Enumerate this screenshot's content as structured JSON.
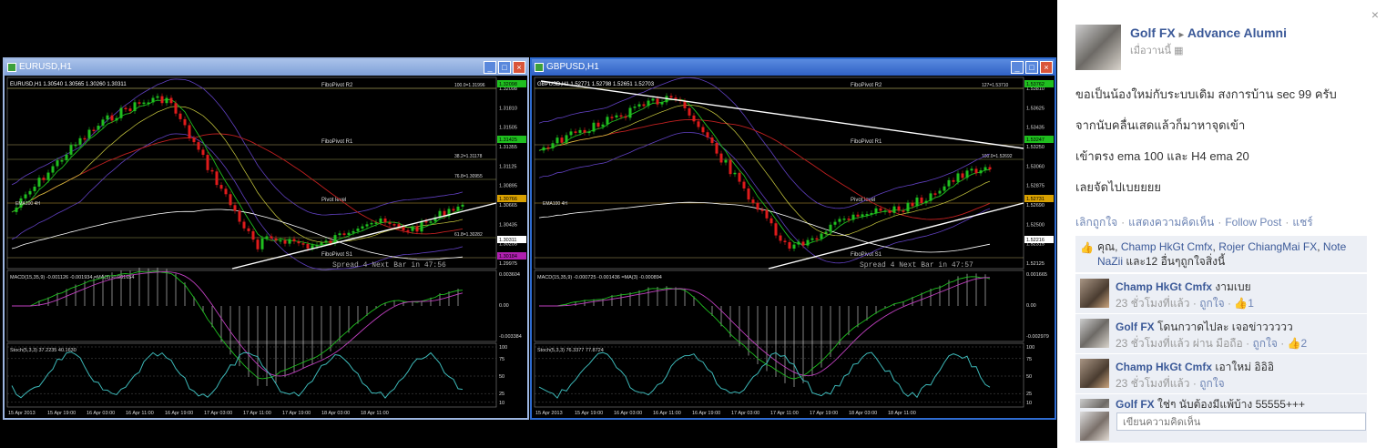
{
  "left_window": {
    "title": "EURUSD,H1",
    "ohlc_line": "EURUSD,H1  1.30540 1.30565 1.30260 1.30311",
    "pivot_labels": [
      "FiboPivot R2",
      "FiboPivot R1",
      "Pivot level",
      "FiboPivot S1"
    ],
    "fib_labels": [
      "100.0=1.31996",
      "38.2=1.31178",
      "76.8=1.30955",
      "61.8=1.30282"
    ],
    "price_ticks": [
      "1.32098",
      "1.31810",
      "1.31505",
      "1.31355",
      "1.31125",
      "1.30895",
      "1.30665",
      "1.30435",
      "1.30205",
      "1.29975"
    ],
    "highlight_prices": [
      "1.32098",
      "1.31425",
      "1.30766",
      "1.30311",
      "1.30184"
    ],
    "spread_text": "Spread  4   Next Bar in 47:56",
    "ema_label": "EMA100 4H",
    "macd_label": "MACD(15,35,9) -0.001126 -0.001934 =MA(3) -0.001654",
    "macd_ticks": [
      "0.003604",
      "0.00",
      "-0.003384"
    ],
    "stoch_label": "Stoch(5,3,3) 37.2235 40.1630",
    "stoch_ticks": [
      "100",
      "75",
      "50",
      "25",
      "10"
    ],
    "time_axis": [
      "15 Apr 2013",
      "15 Apr 19:00",
      "16 Apr 03:00",
      "16 Apr 11:00",
      "16 Apr 19:00",
      "17 Apr 03:00",
      "17 Apr 11:00",
      "17 Apr 19:00",
      "18 Apr 03:00",
      "18 Apr 11:00"
    ]
  },
  "right_window": {
    "title": "GBPUSD,H1",
    "ohlc_line": "GBPUSD,H1  1.52771 1.52798 1.52651 1.52703",
    "pivot_labels": [
      "FiboPivot R2",
      "FiboPivot R1",
      "Pivot level",
      "FiboPivot S1"
    ],
    "fib_labels": [
      "127=1.53710",
      "100.0=1.52692"
    ],
    "price_ticks": [
      "1.53810",
      "1.53625",
      "1.53435",
      "1.53250",
      "1.53060",
      "1.52875",
      "1.52690",
      "1.52500",
      "1.52315",
      "1.52125"
    ],
    "highlight_prices": [
      "1.53762",
      "1.53247",
      "1.52731",
      "1.52216"
    ],
    "spread_text": "Spread  4   Next Bar in 47:57",
    "ema_label": "EMA100 4H",
    "macd_label": "MACD(15,35,9) -0.000725 -0.001436 =MA(3) -0.000894",
    "macd_ticks": [
      "0.001665",
      "0.00",
      "-0.002979"
    ],
    "stoch_label": "Stoch(5,3,3) 76.3377 77.8724",
    "stoch_ticks": [
      "100",
      "75",
      "50",
      "25",
      "10"
    ],
    "time_axis": [
      "15 Apr 2013",
      "15 Apr 19:00",
      "16 Apr 03:00",
      "16 Apr 11:00",
      "16 Apr 19:00",
      "17 Apr 03:00",
      "17 Apr 11:00",
      "17 Apr 19:00",
      "18 Apr 03:00",
      "18 Apr 11:00"
    ]
  },
  "post": {
    "close_glyph": "×",
    "author": "Golf FX",
    "arrow": "▸",
    "group": "Advance Alumni",
    "time": "เมื่อวานนี้",
    "lines": [
      "ขอเป็นน้องใหม่กับระบบเดิม สงการบ้าน sec 99 ครับ",
      "จากนับคลื่นเสดแล้วก็มาหาจุดเข้า",
      "เข้าตรง ema 100 และ H4 ema 20",
      "เลยจัดไปเบยยยย"
    ],
    "actions": [
      "เลิกถูกใจ",
      "แสดงความคิดเห็น",
      "Follow Post",
      "แชร์"
    ],
    "likes": {
      "prefix": "คุณ, ",
      "names": [
        "Champ HkGt Cmfx",
        "Rojer ChiangMai FX",
        "Note NaZii"
      ],
      "suffix": " และ12 อื่นๆถูกใจสิ่งนี้"
    }
  },
  "comments": [
    {
      "name": "Champ HkGt Cmfx",
      "text": "งามเบย",
      "time": "23 ชั่วโมงที่แล้ว",
      "via": "",
      "like": "ถูกใจ",
      "count": "1"
    },
    {
      "name": "Golf FX",
      "text": "โดนกวาดไปละ เจอข่าววววว",
      "time": "23 ชั่วโมงที่แล้ว",
      "via": "ผ่าน มือถือ",
      "like": "ถูกใจ",
      "count": "2"
    },
    {
      "name": "Champ HkGt Cmfx",
      "text": "เอาใหม่ อิอิอิ",
      "time": "23 ชั่วโมงที่แล้ว",
      "via": "",
      "like": "ถูกใจ",
      "count": ""
    },
    {
      "name": "Golf FX",
      "text": "ใช่ๆ นับต้องมีแพ้บ้าง 55555+++",
      "time": "",
      "via": "",
      "like": "",
      "count": ""
    }
  ],
  "write_placeholder": "เขียนความคิดเห็น",
  "colors": {
    "fb_blue": "#3b5998",
    "fb_link": "#6d84b4",
    "candle_up": "#1fbf1f",
    "candle_down": "#e01b1b"
  }
}
